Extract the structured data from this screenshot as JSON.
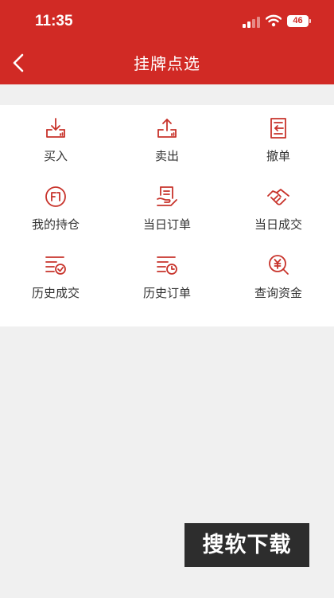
{
  "status_bar": {
    "time": "11:35",
    "battery": "46"
  },
  "header": {
    "title": "挂牌点选"
  },
  "colors": {
    "brand_red": "#d12a25",
    "icon_red": "#c8332b"
  },
  "menu": [
    {
      "label": "买入",
      "icon": "buy-icon"
    },
    {
      "label": "卖出",
      "icon": "sell-icon"
    },
    {
      "label": "撤单",
      "icon": "cancel-order-icon"
    },
    {
      "label": "我的持仓",
      "icon": "holdings-icon"
    },
    {
      "label": "当日订单",
      "icon": "today-orders-icon"
    },
    {
      "label": "当日成交",
      "icon": "today-deals-icon"
    },
    {
      "label": "历史成交",
      "icon": "history-deals-icon"
    },
    {
      "label": "历史订单",
      "icon": "history-orders-icon"
    },
    {
      "label": "查询资金",
      "icon": "query-funds-icon"
    }
  ],
  "watermark": "搜软下载"
}
